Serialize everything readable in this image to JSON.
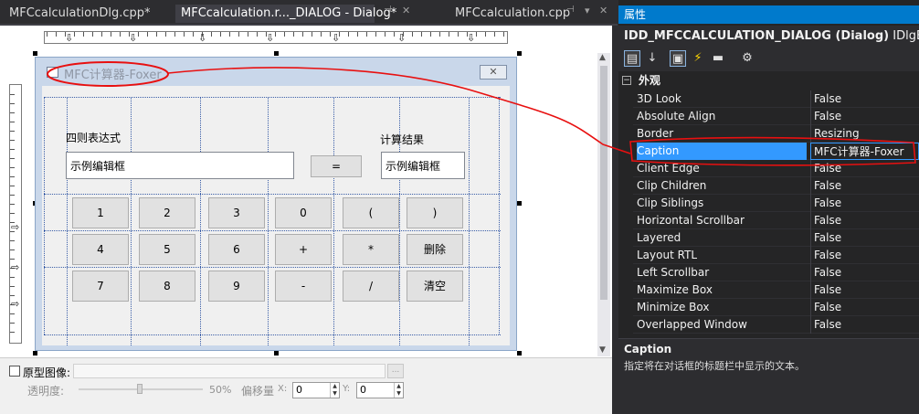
{
  "tabs": [
    {
      "label": "MFCcalculationDlg.cpp*"
    },
    {
      "label": "MFCcalculation.r..._DIALOG - Dialog*"
    },
    {
      "label": "MFCcalculation.cpp"
    }
  ],
  "dialog": {
    "title": "MFC计算器-Foxer",
    "close_glyph": "✕",
    "expr_label": "四则表达式",
    "result_label": "计算结果",
    "expr_edit_text": "示例编辑框",
    "result_edit_text": "示例编辑框",
    "equals_label": "=",
    "buttons": [
      [
        "1",
        "2",
        "3",
        "0",
        "(",
        ")"
      ],
      [
        "4",
        "5",
        "6",
        "+",
        "*",
        "删除"
      ],
      [
        "7",
        "8",
        "9",
        "-",
        "/",
        "清空"
      ]
    ]
  },
  "bottom_bar": {
    "prototype_label": "原型图像:",
    "browse_label": "...",
    "opacity_label": "透明度:",
    "opacity_value_label": "50%",
    "opacity_value": 0.5,
    "offset_label": "偏移量",
    "x_label": "X:",
    "x_value": "0",
    "y_label": "Y:",
    "y_value": "0"
  },
  "properties": {
    "panel_title": "属性",
    "object_name": "IDD_MFCCALCULATION_DIALOG (Dialog)",
    "object_type": "IDlgEditor",
    "category": "外观",
    "category_toggle": "−",
    "rows": [
      {
        "name": "3D Look",
        "value": "False"
      },
      {
        "name": "Absolute Align",
        "value": "False"
      },
      {
        "name": "Border",
        "value": "Resizing"
      },
      {
        "name": "Caption",
        "value": "MFC计算器-Foxer"
      },
      {
        "name": "Client Edge",
        "value": "False"
      },
      {
        "name": "Clip Children",
        "value": "False"
      },
      {
        "name": "Clip Siblings",
        "value": "False"
      },
      {
        "name": "Horizontal Scrollbar",
        "value": "False"
      },
      {
        "name": "Layered",
        "value": "False"
      },
      {
        "name": "Layout RTL",
        "value": "False"
      },
      {
        "name": "Left Scrollbar",
        "value": "False"
      },
      {
        "name": "Maximize Box",
        "value": "False"
      },
      {
        "name": "Minimize Box",
        "value": "False"
      },
      {
        "name": "Overlapped Window",
        "value": "False"
      }
    ],
    "selected_row": "Caption",
    "description_title": "Caption",
    "description_text": "指定将在对话框的标题栏中显示的文本。"
  },
  "colors": {
    "accent": "#007acc",
    "selection": "#3399ff",
    "annotation": "#e81010",
    "dialog_frame": "#c9d7ea"
  }
}
